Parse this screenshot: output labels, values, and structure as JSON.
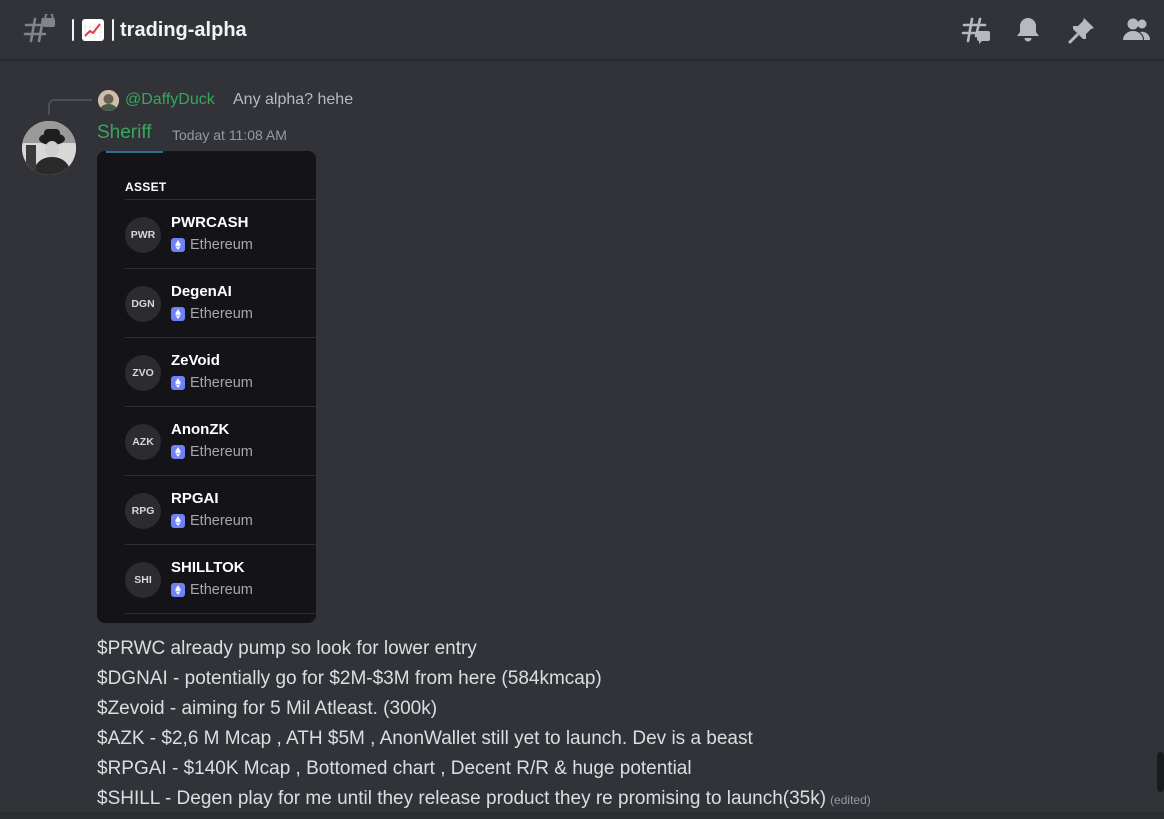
{
  "header": {
    "channel_name": "trading-alpha",
    "icons": [
      "hashtag-lock-icon",
      "chart-increasing-emoji",
      "threads-icon",
      "bell-icon",
      "pin-icon",
      "members-icon"
    ]
  },
  "reply": {
    "author": "@DaffyDuck",
    "text": "Any alpha? hehe"
  },
  "message": {
    "author": "Sheriff",
    "timestamp": "Today at 11:08 AM",
    "edited_label": "(edited)",
    "lines": [
      "$PRWC already pump so look for lower entry",
      "$DGNAI - potentially go for $2M-$3M from here (584kmcap)",
      "$Zevoid - aiming for 5 Mil Atleast. (300k)",
      "$AZK - $2,6 M Mcap , ATH $5M , AnonWallet still yet to launch. Dev is a beast",
      "$RPGAI - $140K Mcap , Bottomed chart , Decent R/R & huge potential",
      "$SHILL - Degen play for me until they release product they re promising to launch(35k)"
    ]
  },
  "embed": {
    "header": "ASSET",
    "assets": [
      {
        "ticker": "PWR",
        "name": "PWRCASH",
        "chain": "Ethereum"
      },
      {
        "ticker": "DGN",
        "name": "DegenAI",
        "chain": "Ethereum"
      },
      {
        "ticker": "ZVO",
        "name": "ZeVoid",
        "chain": "Ethereum"
      },
      {
        "ticker": "AZK",
        "name": "AnonZK",
        "chain": "Ethereum"
      },
      {
        "ticker": "RPG",
        "name": "RPGAI",
        "chain": "Ethereum"
      },
      {
        "ticker": "SHI",
        "name": "SHILLTOK",
        "chain": "Ethereum"
      }
    ]
  },
  "colors": {
    "background": "#313338",
    "username": "#3ba55c",
    "reply_author": "#3aa55d",
    "embed_bg": "#141418",
    "eth_badge": "#6f82f5"
  }
}
